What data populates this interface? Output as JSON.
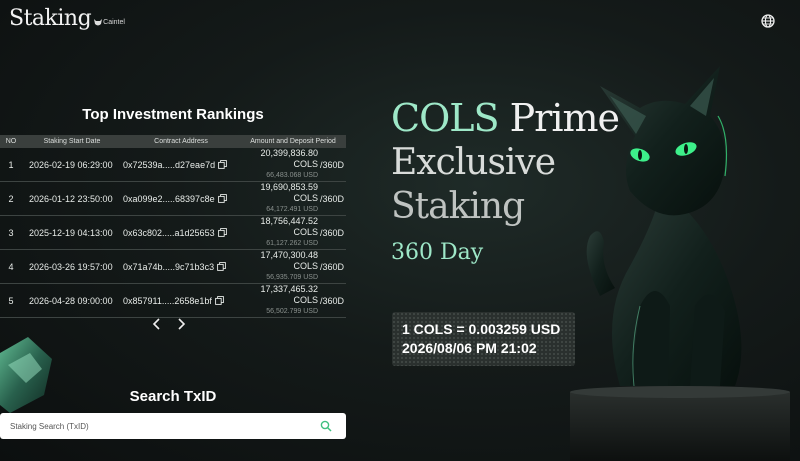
{
  "header": {
    "title": "Staking",
    "brand_mark": "Caintel",
    "globe_icon": "globe-icon"
  },
  "rankings": {
    "title": "Top Investment Rankings",
    "columns": [
      "NO",
      "Staking Start Date",
      "Contract Address",
      "Amount and Deposit Period"
    ],
    "rows": [
      {
        "no": "1",
        "date": "2026-02-19 06:29:00",
        "address": "0x72539a.....d27eae7d",
        "amount": "20,399,836.80 COLS",
        "usd": "66,483.068 USD",
        "period": "/360D"
      },
      {
        "no": "2",
        "date": "2026-01-12 23:50:00",
        "address": "0xa099e2.....68397c8e",
        "amount": "19,690,853.59 COLS",
        "usd": "64,172.491 USD",
        "period": "/360D"
      },
      {
        "no": "3",
        "date": "2025-12-19 04:13:00",
        "address": "0x63c802.....a1d25653",
        "amount": "18,756,447.52 COLS",
        "usd": "61,127.262 USD",
        "period": "/360D"
      },
      {
        "no": "4",
        "date": "2026-03-26 19:57:00",
        "address": "0x71a74b.....9c71b3c3",
        "amount": "17,470,300.48 COLS",
        "usd": "56,935.709 USD",
        "period": "/360D"
      },
      {
        "no": "5",
        "date": "2026-04-28 09:00:00",
        "address": "0x857911.....2658e1bf",
        "amount": "17,337,465.32 COLS",
        "usd": "56,502.799 USD",
        "period": "/360D"
      }
    ]
  },
  "search": {
    "title": "Search TxID",
    "placeholder": "Staking Search (TxID)"
  },
  "hero": {
    "accent": "COLS",
    "line1_rest": " Prime",
    "line2": "Exclusive",
    "line3": "Staking",
    "line4": "360 Day"
  },
  "price": {
    "rate": "1 COLS = 0.003259 USD",
    "datetime": "2026/08/06 PM 21:02"
  },
  "colors": {
    "accent": "#9ee8c8",
    "background": "#141a19",
    "glow": "#3df08a"
  }
}
